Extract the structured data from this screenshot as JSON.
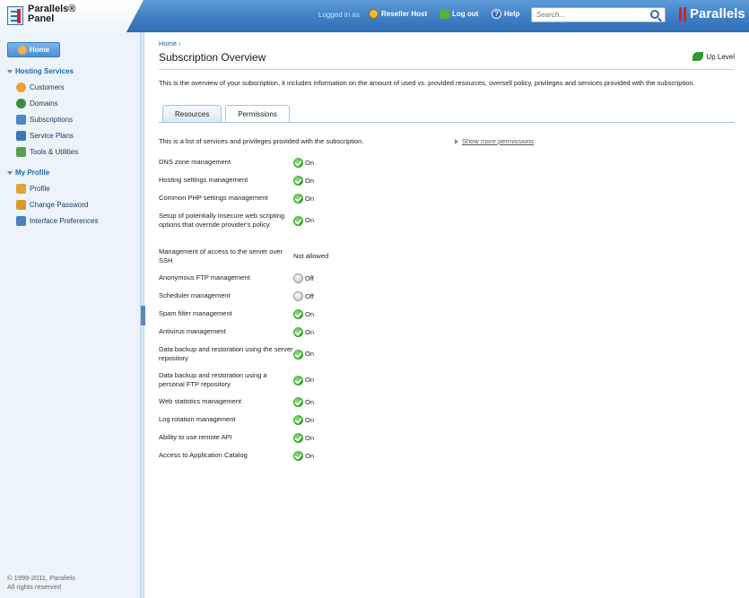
{
  "header": {
    "product_name_line1": "Parallels®",
    "product_name_line2": "Panel",
    "logged_in_as": "Logged in as",
    "user_name": "Reseller Host",
    "logout_label": "Log out",
    "help_label": "Help",
    "search_placeholder": "Search...",
    "brand": "Parallels"
  },
  "sidebar": {
    "home_label": "Home",
    "sections": [
      {
        "title": "Hosting Services",
        "items": [
          {
            "label": "Customers",
            "icon": "customers-icon"
          },
          {
            "label": "Domains",
            "icon": "domains-icon"
          },
          {
            "label": "Subscriptions",
            "icon": "subscriptions-icon"
          },
          {
            "label": "Service Plans",
            "icon": "service-plans-icon"
          },
          {
            "label": "Tools & Utilities",
            "icon": "tools-icon"
          }
        ]
      },
      {
        "title": "My Profile",
        "items": [
          {
            "label": "Profile",
            "icon": "profile-icon"
          },
          {
            "label": "Change Password",
            "icon": "key-icon"
          },
          {
            "label": "Interface Preferences",
            "icon": "preferences-icon"
          }
        ]
      }
    ],
    "copyright_line1": "© 1999-2011, Parallels",
    "copyright_line2": "All rights reserved"
  },
  "main": {
    "breadcrumb": "Home ›",
    "title": "Subscription Overview",
    "up_level": "Up Level",
    "description": "This is the overview of your subscription, it includes information on the amount of used vs. provided resources, oversell policy, privileges and services provided with the subscription.",
    "tabs": [
      "Resources",
      "Permissions"
    ],
    "active_tab": "Permissions",
    "list_intro": "This is a list of services and privileges provided with the subscription.",
    "show_more": "Show more permissions",
    "permissions": [
      {
        "label": "DNS zone management",
        "status": "on",
        "value": "On"
      },
      {
        "label": "Hosting settings management",
        "status": "on",
        "value": "On"
      },
      {
        "label": "Common PHP settings management",
        "status": "on",
        "value": "On"
      },
      {
        "label": "Setup of potentially insecure web scripting options that override provider's policy",
        "status": "on",
        "value": "On"
      },
      {
        "label": "Management of access to the server over SSH",
        "status": "text",
        "value": "Not allowed"
      },
      {
        "label": "Anonymous FTP management",
        "status": "off",
        "value": "Off"
      },
      {
        "label": "Scheduler management",
        "status": "off",
        "value": "Off"
      },
      {
        "label": "Spam filter management",
        "status": "on",
        "value": "On"
      },
      {
        "label": "Antivirus management",
        "status": "on",
        "value": "On"
      },
      {
        "label": "Data backup and restoration using the server repository",
        "status": "on",
        "value": "On"
      },
      {
        "label": "Data backup and restoration using a personal FTP repository",
        "status": "on",
        "value": "On"
      },
      {
        "label": "Web statistics management",
        "status": "on",
        "value": "On"
      },
      {
        "label": "Log rotation management",
        "status": "on",
        "value": "On"
      },
      {
        "label": "Ability to use remote API",
        "status": "on",
        "value": "On"
      },
      {
        "label": "Access to Application Catalog",
        "status": "on",
        "value": "On"
      }
    ]
  },
  "colors": {
    "header_blue": "#3f7fc4",
    "link_blue": "#1f66b5",
    "sidebar_bg": "#ecf3fb",
    "on_green": "#3aa52c",
    "brand_red": "#d2232a"
  }
}
